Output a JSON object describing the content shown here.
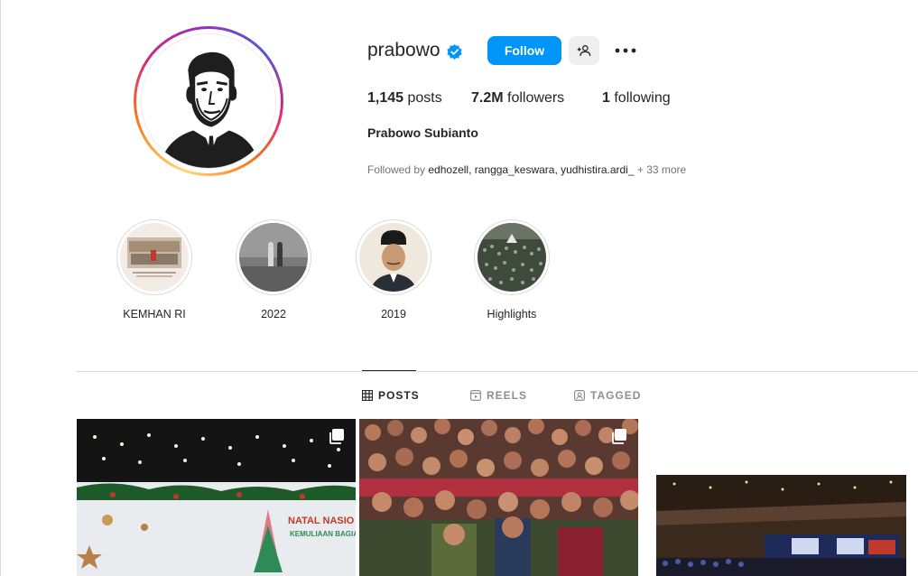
{
  "profile": {
    "username": "prabowo",
    "verified": true,
    "follow_label": "Follow",
    "posts_count": "1,145",
    "posts_label": "posts",
    "followers_count": "7.2M",
    "followers_label": "followers",
    "following_count": "1",
    "following_label": "following",
    "full_name": "Prabowo Subianto",
    "followed_by_prefix": "Followed by ",
    "followed_by_names": "edhozell, rangga_keswara, yudhistira.ardi_",
    "followed_by_more": " + 33 more"
  },
  "highlights": [
    {
      "label": "KEMHAN RI"
    },
    {
      "label": "2022"
    },
    {
      "label": "2019"
    },
    {
      "label": "Highlights"
    }
  ],
  "tabs": [
    {
      "label": "POSTS",
      "active": true
    },
    {
      "label": "REELS",
      "active": false
    },
    {
      "label": "TAGGED",
      "active": false
    }
  ],
  "posts": {
    "post1_banner_text": "NATAL NASIO",
    "post1_banner_subtext": "KEMULIAAN BAGIA"
  },
  "colors": {
    "accent": "#0095f6",
    "verified": "#0095f6",
    "text": "#262626",
    "muted": "#737373"
  },
  "icons": [
    "verified-badge-icon",
    "add-person-icon",
    "more-options-icon",
    "grid-icon",
    "reels-icon",
    "tagged-icon",
    "multiple-posts-icon"
  ]
}
